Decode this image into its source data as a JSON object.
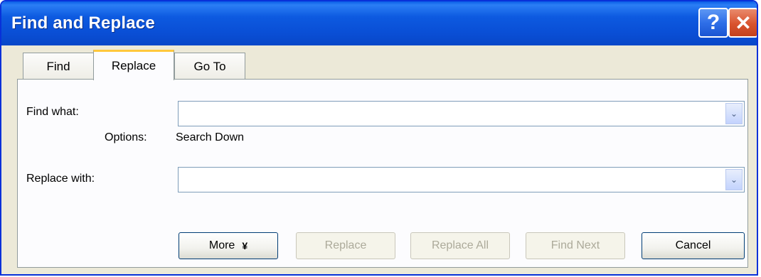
{
  "window": {
    "title": "Find and Replace",
    "help_label": "?",
    "close_label": "✕"
  },
  "tabs": [
    {
      "label": "Find",
      "active": false
    },
    {
      "label": "Replace",
      "active": true
    },
    {
      "label": "Go To",
      "active": false
    }
  ],
  "find_what": {
    "label": "Find what:",
    "value": "",
    "options_label": "Options:",
    "options_value": "Search Down"
  },
  "replace_with": {
    "label": "Replace with:",
    "value": ""
  },
  "dropdown_glyph": "⌄",
  "buttons": {
    "more": "More",
    "more_glyph": "¥",
    "replace": "Replace",
    "replace_all": "Replace All",
    "find_next": "Find Next",
    "cancel": "Cancel"
  },
  "colors": {
    "titlebar": "#0a4fd6",
    "dialog_bg": "#ece9d8",
    "active_tab_accent": "#ffc83c",
    "close_button": "#d9532e"
  }
}
